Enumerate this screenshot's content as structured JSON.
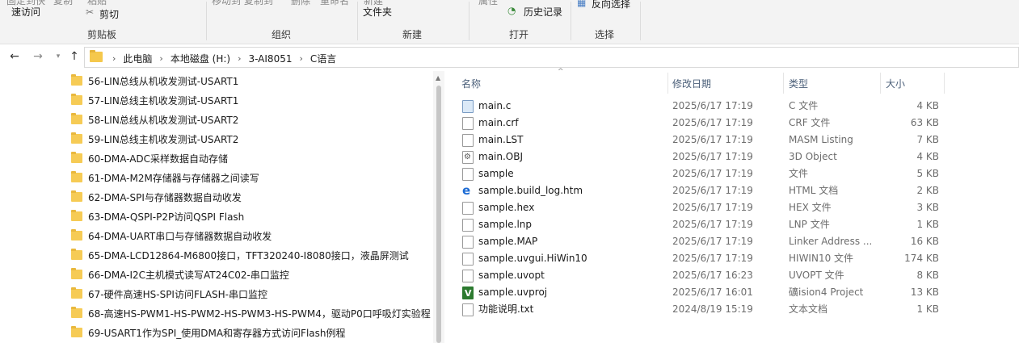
{
  "ribbon": {
    "clipped_top_left_a": "固定到快",
    "clipped_top_left_b": "复制",
    "clipped_top_left_c": "粘贴",
    "quick_access_label": "速访问",
    "cut_label": "剪切",
    "clipped_organize": "移动到 复制到",
    "clipped_delete": "删除",
    "clipped_rename": "重命名",
    "clipped_new_item": "新建",
    "new_folder_label": "文件夹",
    "clipped_properties": "属性",
    "history_label": "历史记录",
    "invert_selection_label": "反向选择",
    "groups": {
      "clipboard": "剪贴板",
      "organize": "组织",
      "new": "新建",
      "open": "打开",
      "select": "选择"
    }
  },
  "address_bar": {
    "crumbs": [
      "此电脑",
      "本地磁盘 (H:)",
      "3-AI8051",
      "C语言"
    ]
  },
  "tree": {
    "items": [
      "56-LIN总线从机收发测试-USART1",
      "57-LIN总线主机收发测试-USART1",
      "58-LIN总线从机收发测试-USART2",
      "59-LIN总线主机收发测试-USART2",
      "60-DMA-ADC采样数据自动存储",
      "61-DMA-M2M存储器与存储器之间读写",
      "62-DMA-SPI与存储器数据自动收发",
      "63-DMA-QSPI-P2P访问QSPI Flash",
      "64-DMA-UART串口与存储器数据自动收发",
      "65-DMA-LCD12864-M6800接口，TFT320240-I8080接口，液晶屏测试",
      "66-DMA-I2C主机模式读写AT24C02-串口监控",
      "67-硬件高速HS-SPI访问FLASH-串口监控",
      "68-高速HS-PWM1-HS-PWM2-HS-PWM3-HS-PWM4，驱动P0口呼吸灯实验程",
      "69-USART1作为SPI_使用DMA和寄存器方式访问Flash例程"
    ]
  },
  "filelist": {
    "headers": {
      "name": "名称",
      "date": "修改日期",
      "type": "类型",
      "size": "大小"
    },
    "files": [
      {
        "name": "main.c",
        "date": "2025/6/17 17:19",
        "type": "C 文件",
        "size": "4 KB",
        "icon": "c-file-icon"
      },
      {
        "name": "main.crf",
        "date": "2025/6/17 17:19",
        "type": "CRF 文件",
        "size": "63 KB",
        "icon": "file-icon"
      },
      {
        "name": "main.LST",
        "date": "2025/6/17 17:19",
        "type": "MASM Listing",
        "size": "7 KB",
        "icon": "file-icon"
      },
      {
        "name": "main.OBJ",
        "date": "2025/6/17 17:19",
        "type": "3D Object",
        "size": "4 KB",
        "icon": "obj-file-icon"
      },
      {
        "name": "sample",
        "date": "2025/6/17 17:19",
        "type": "文件",
        "size": "5 KB",
        "icon": "file-icon"
      },
      {
        "name": "sample.build_log.htm",
        "date": "2025/6/17 17:19",
        "type": "HTML 文档",
        "size": "2 KB",
        "icon": "edge-html-icon"
      },
      {
        "name": "sample.hex",
        "date": "2025/6/17 17:19",
        "type": "HEX 文件",
        "size": "3 KB",
        "icon": "file-icon"
      },
      {
        "name": "sample.lnp",
        "date": "2025/6/17 17:19",
        "type": "LNP 文件",
        "size": "1 KB",
        "icon": "file-icon"
      },
      {
        "name": "sample.MAP",
        "date": "2025/6/17 17:19",
        "type": "Linker Address ...",
        "size": "16 KB",
        "icon": "file-icon"
      },
      {
        "name": "sample.uvgui.HiWin10",
        "date": "2025/6/17 17:19",
        "type": "HIWIN10 文件",
        "size": "174 KB",
        "icon": "file-icon"
      },
      {
        "name": "sample.uvopt",
        "date": "2025/6/17 16:23",
        "type": "UVOPT 文件",
        "size": "8 KB",
        "icon": "file-icon"
      },
      {
        "name": "sample.uvproj",
        "date": "2025/6/17 16:01",
        "type": "礦ision4 Project",
        "size": "13 KB",
        "icon": "keil-project-icon"
      },
      {
        "name": "功能说明.txt",
        "date": "2024/8/19 15:19",
        "type": "文本文档",
        "size": "1 KB",
        "icon": "text-file-icon"
      }
    ]
  }
}
